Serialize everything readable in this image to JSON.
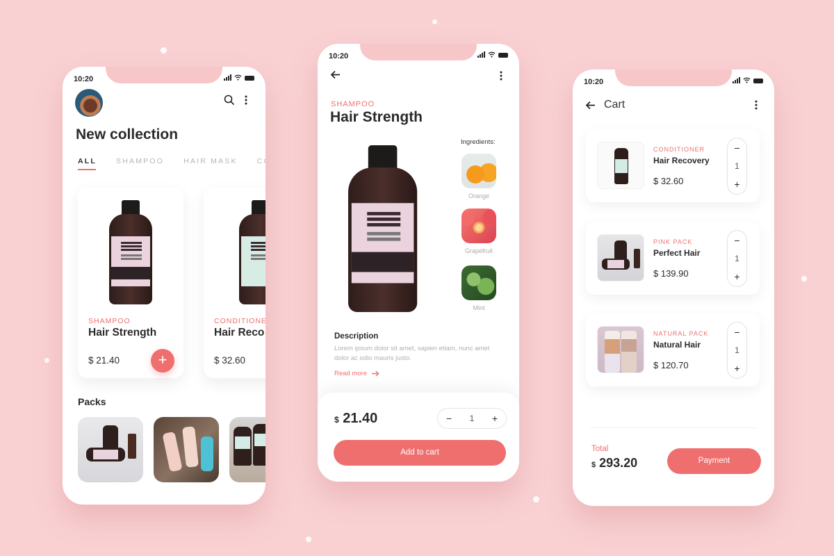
{
  "status": {
    "time": "10:20"
  },
  "colors": {
    "accent": "#ef6f6f",
    "background": "#f9d1d3"
  },
  "collection": {
    "title": "New collection",
    "icons": [
      "search-icon",
      "more-vertical-icon"
    ],
    "tabs": [
      {
        "label": "ALL",
        "active": true
      },
      {
        "label": "SHAMPOO"
      },
      {
        "label": "HAIR MASK"
      },
      {
        "label": "CON"
      }
    ],
    "products": [
      {
        "category": "SHAMPOO",
        "name": "Hair Strength",
        "price": "$ 21.40",
        "add_label": "+"
      },
      {
        "category": "CONDITIONE",
        "name": "Hair Reco",
        "price": "$ 32.60"
      }
    ],
    "packs_title": "Packs"
  },
  "detail": {
    "category": "SHAMPOO",
    "title": "Hair Strength",
    "ingredients_title": "Ingredients:",
    "ingredients": [
      {
        "label": "Orange"
      },
      {
        "label": "Grapefruit"
      },
      {
        "label": "Mint"
      }
    ],
    "description_title": "Description",
    "description": "Lorem ipsum dolor sit amet, sapien etiam, nunc amet dolor ac odio mauris justo.",
    "read_more": "Read more",
    "currency": "$",
    "price": "21.40",
    "quantity": "1",
    "minus": "−",
    "plus": "+",
    "add_to_cart": "Add to cart"
  },
  "cart": {
    "title": "Cart",
    "items": [
      {
        "category": "CONDITIONER",
        "name": "Hair Recovery",
        "price": "$ 32.60",
        "quantity": "1"
      },
      {
        "category": "PINK PACK",
        "name": "Perfect Hair",
        "price": "$ 139.90",
        "quantity": "1"
      },
      {
        "category": "NATURAL PACK",
        "name": "Natural Hair",
        "price": "$ 120.70",
        "quantity": "1"
      }
    ],
    "minus": "−",
    "plus": "+",
    "total_label": "Total",
    "currency": "$",
    "total": "293.20",
    "payment": "Payment"
  }
}
